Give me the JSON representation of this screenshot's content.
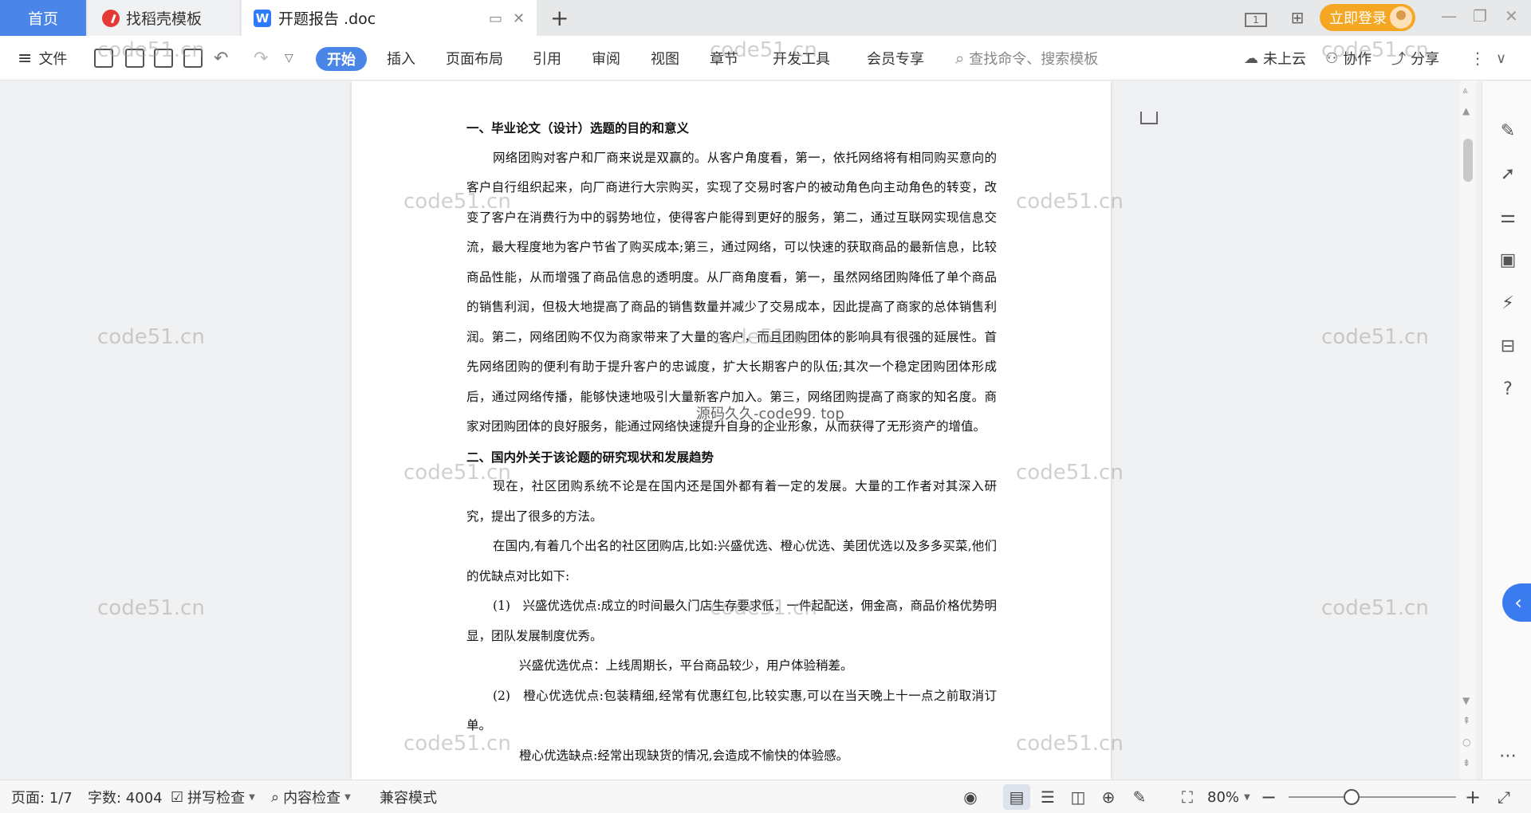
{
  "tabs": {
    "home": "首页",
    "daoke": "找稻壳模板",
    "doc": "开题报告 .doc",
    "new_tab": "+"
  },
  "titlebar": {
    "login": "立即登录",
    "page_indicator": "1"
  },
  "ribbon": {
    "file": "文件",
    "tabs": [
      "开始",
      "插入",
      "页面布局",
      "引用",
      "审阅",
      "视图",
      "章节",
      "开发工具",
      "会员专享"
    ],
    "search_placeholder": "查找命令、搜索模板",
    "cloud": "未上云",
    "collab": "协作",
    "share": "分享"
  },
  "document": {
    "heading1": "一、毕业论文（设计）选题的目的和意义",
    "para1": "网络团购对客户和厂商来说是双赢的。从客户角度看，第一，依托网络将有相同购买意向的客户自行组织起来，向厂商进行大宗购买，实现了交易时客户的被动角色向主动角色的转变，改变了客户在消费行为中的弱势地位，使得客户能得到更好的服务，第二，通过互联网实现信息交流，最大程度地为客户节省了购买成本;第三，通过网络，可以快速的获取商品的最新信息，比较商品性能，从而增强了商品信息的透明度。从厂商角度看，第一，虽然网络团购降低了单个商品的销售利润，但极大地提高了商品的销售数量并减少了交易成本，因此提高了商家的总体销售利润。第二，网络团购不仅为商家带来了大量的客户，而且团购团体的影响具有很强的延展性。首先网络团购的便利有助于提升客户的忠诚度，扩大长期客户的队伍;其次一个稳定团购团体形成后，通过网络传播，能够快速地吸引大量新客户加入。第三，网络团购提高了商家的知名度。商家对团购团体的良好服务，能通过网络快速提升自身的企业形象，从而获得了无形资产的增值。",
    "heading2": "二、国内外关于该论题的研究现状和发展趋势",
    "para2": "现在，社区团购系统不论是在国内还是国外都有着一定的发展。大量的工作者对其深入研究，提出了很多的方法。",
    "para3": "在国内,有着几个出名的社区团购店,比如:兴盛优选、橙心优选、美团优选以及多多买菜,他们的优缺点对比如下:",
    "item1": "(1)　兴盛优选优点:成立的时间最久门店生存要求低，一件起配送，佣金高，商品价格优势明显，团队发展制度优秀。",
    "item1b": "兴盛优选优点：上线周期长，平台商品较少，用户体验稍差。",
    "item2": "(2)　橙心优选优点:包装精细,经常有优惠红包,比较实惠,可以在当天晚上十一点之前取消订单。",
    "item2b": "橙心优选缺点:经常出现缺货的情况,会造成不愉快的体验感。"
  },
  "watermarks": {
    "text": "code51.cn",
    "center": "源码久久-code99. top"
  },
  "status": {
    "page": "页面: 1/7",
    "words": "字数: 4004",
    "spell": "拼写检查",
    "content": "内容检查",
    "compat": "兼容模式",
    "zoom": "80%"
  },
  "icons": {
    "save": "save-icon",
    "undo": "undo-icon",
    "redo": "redo-icon"
  }
}
